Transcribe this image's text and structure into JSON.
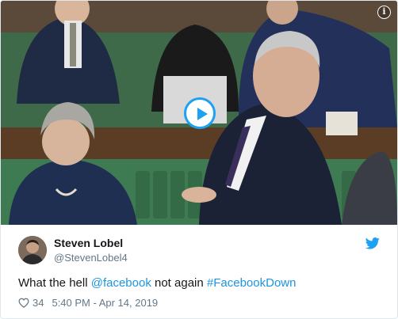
{
  "tweet": {
    "author_name": "Steven Lobel",
    "author_handle": "@StevenLobel4",
    "text_parts": {
      "prefix": "What the hell ",
      "mention": "@facebook",
      "middle": " not again ",
      "hashtag": "#FacebookDown"
    },
    "like_count": "34",
    "timestamp": "5:40 PM - Apr 14, 2019"
  },
  "icons": {
    "play": "play-icon",
    "info": "info-icon",
    "bird": "twitter-bird-icon",
    "heart": "heart-icon"
  },
  "colors": {
    "accent": "#1da1f2",
    "link": "#1b95e0",
    "secondary_text": "#657786",
    "primary_text": "#14171a",
    "border": "#e1e8ed"
  },
  "media": {
    "info_glyph": "i"
  }
}
